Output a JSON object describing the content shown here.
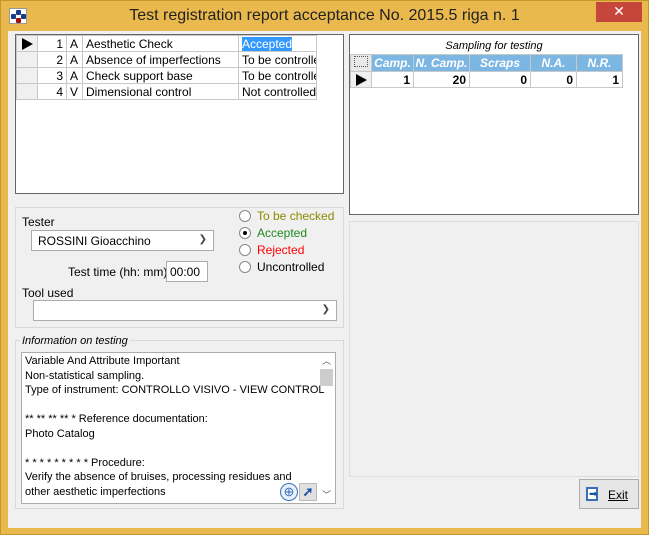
{
  "window": {
    "title": "Test registration report acceptance No. 2015.5 riga n. 1",
    "close": "✕"
  },
  "checks": [
    {
      "n": "1",
      "type": "A",
      "name": "Aesthetic Check",
      "status": "Accepted",
      "selected": true
    },
    {
      "n": "2",
      "type": "A",
      "name": "Absence of imperfections",
      "status": "To be controlle"
    },
    {
      "n": "3",
      "type": "A",
      "name": "Check support base",
      "status": "To be controlle"
    },
    {
      "n": "4",
      "type": "V",
      "name": "Dimensional control",
      "status": "Not controlled"
    }
  ],
  "sampling": {
    "caption": "Sampling for testing",
    "headers": [
      "Camp.",
      "N. Camp.",
      "Scraps",
      "N.A.",
      "N.R."
    ],
    "row": [
      "1",
      "20",
      "0",
      "0",
      "1"
    ]
  },
  "tester": {
    "label": "Tester",
    "value": "ROSSINI Gioacchino",
    "time_label": "Test time (hh: mm)",
    "time_value": "00:00",
    "tool_label": "Tool used",
    "tool_value": ""
  },
  "outcome": {
    "options": [
      {
        "label": "To be checked",
        "color": "#8a8a00",
        "checked": false
      },
      {
        "label": "Accepted",
        "color": "#1e8a1e",
        "checked": true
      },
      {
        "label": "Rejected",
        "color": "#ff0000",
        "checked": false
      },
      {
        "label": "Uncontrolled",
        "color": "#000000",
        "checked": false
      }
    ]
  },
  "info": {
    "caption": "Information on testing",
    "lines": [
      "Variable And Attribute Important",
      "Non-statistical sampling.",
      "Type of instrument: CONTROLLO VISIVO - VIEW CONTROL",
      "",
      "** ** ** ** * Reference documentation:",
      "Photo Catalog",
      "",
      "* * * * * * * * * Procedure:",
      "Verify the absence of bruises, processing residues and",
      "other aesthetic imperfections"
    ]
  },
  "exit": {
    "label": "Exit"
  }
}
